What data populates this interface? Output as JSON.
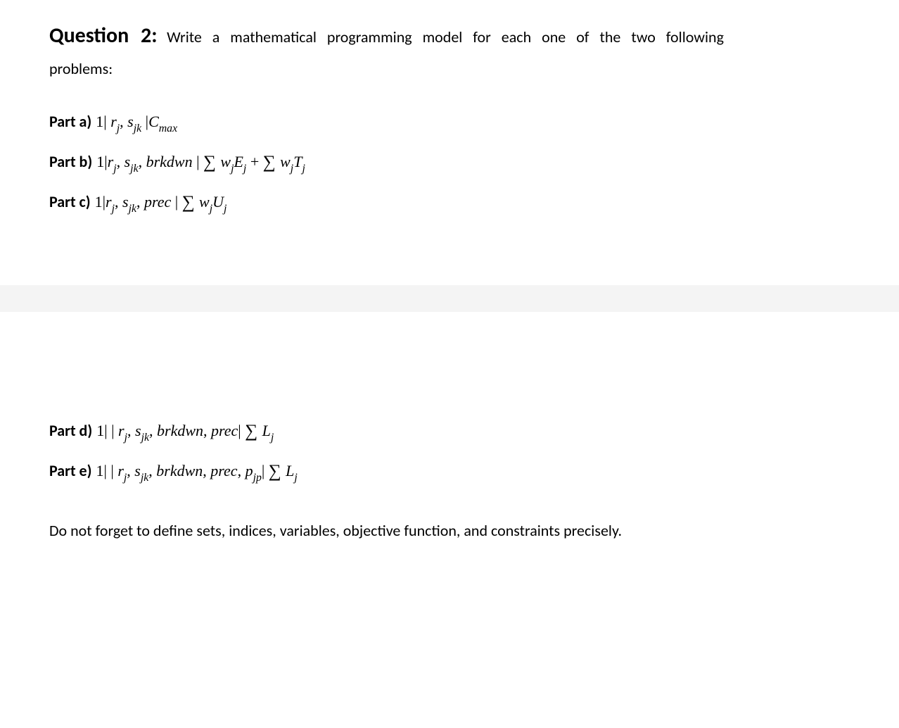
{
  "question": {
    "label": "Question 2:",
    "intro_line1": "Write a mathematical programming model for each one of the two following",
    "intro_line2": "problems:"
  },
  "parts": {
    "a": {
      "label": "Part a)",
      "prefix": "1| ",
      "r": "r",
      "r_sub": "j",
      "comma1": ", ",
      "s": "s",
      "s_sub": "jk",
      "mid": " |",
      "C": "C",
      "C_sub": "max"
    },
    "b": {
      "label": "Part b)",
      "prefix": "1|",
      "r": "r",
      "r_sub": "j",
      "comma1": ", ",
      "s": "s",
      "s_sub": "jk",
      "comma2": ", ",
      "brkdwn": "brkdwn",
      "mid": " | ",
      "sum1": "∑ ",
      "w1": "w",
      "w1_sub": "j",
      "E": "E",
      "E_sub": "j",
      "plus": " + ",
      "sum2": "∑ ",
      "w2": "w",
      "w2_sub": "j",
      "T": "T",
      "T_sub": "j"
    },
    "c": {
      "label": "Part c)",
      "prefix": "1|",
      "r": "r",
      "r_sub": "j",
      "comma1": ", ",
      "s": "s",
      "s_sub": "jk",
      "comma2": ", ",
      "prec": "prec",
      "mid": " | ",
      "sum": "∑ ",
      "w": "w",
      "w_sub": "j",
      "U": "U",
      "U_sub": "j"
    },
    "d": {
      "label": "Part d)",
      "prefix": "1| | ",
      "r": "r",
      "r_sub": "j",
      "comma1": ", ",
      "s": "s",
      "s_sub": "jk",
      "comma2": ", ",
      "brkdwn": "brkdwn",
      "comma3": ", ",
      "prec": "prec",
      "mid": "| ",
      "sum": "∑ ",
      "L": "L",
      "L_sub": "j"
    },
    "e": {
      "label": "Part e)",
      "prefix": "1| | ",
      "r": "r",
      "r_sub": "j",
      "comma1": ", ",
      "s": "s",
      "s_sub": "jk",
      "comma2": ", ",
      "brkdwn": "brkdwn",
      "comma3": ", ",
      "prec": "prec",
      "comma4": ", ",
      "p": "p",
      "p_sub": "jp",
      "mid": "| ",
      "sum": "∑ ",
      "L": "L",
      "L_sub": "j"
    }
  },
  "footer": "Do not forget to define sets, indices, variables, objective function, and constraints precisely."
}
